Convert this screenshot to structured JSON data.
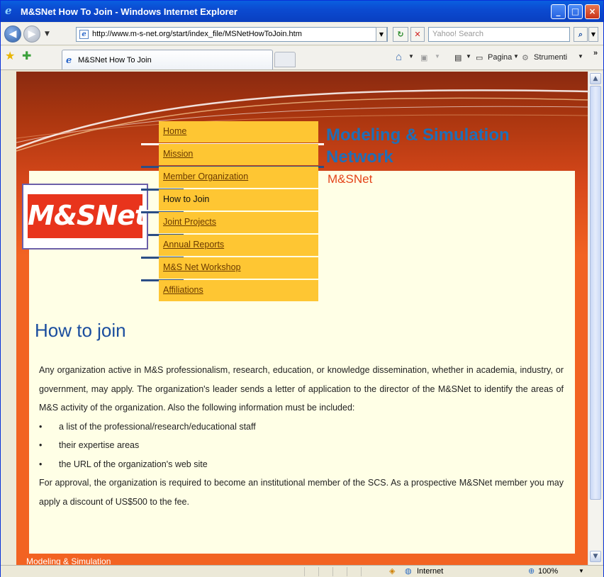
{
  "window": {
    "title": "M&SNet How To Join - Windows Internet Explorer",
    "minimize_label": "_",
    "maximize_label": "□",
    "close_label": "×"
  },
  "toolbar": {
    "address": "http://www.m-s-net.org/start/index_file/MSNetHowToJoin.htm",
    "search_placeholder": "Yahoo! Search"
  },
  "tabs": {
    "active_label": "M&SNet How To Join",
    "pagina_label": "Pagina",
    "strumenti_label": "Strumenti"
  },
  "site": {
    "title": "Modeling & Simulation Network",
    "subtitle": "M&SNet",
    "logo_text": "M&SNet"
  },
  "nav": [
    {
      "label": "Home",
      "link": true
    },
    {
      "label": "Mission",
      "link": true
    },
    {
      "label": "Member Organization",
      "link": true
    },
    {
      "label": "How to Join",
      "link": false
    },
    {
      "label": "Joint Projects",
      "link": true
    },
    {
      "label": "Annual Reports",
      "link": true
    },
    {
      "label": "M&S Net Workshop",
      "link": true
    },
    {
      "label": "Affiliations",
      "link": true
    }
  ],
  "content": {
    "heading": "How to join",
    "intro": "Any organization active in M&S professionalism, research, education, or knowledge dissemination, whether in academia, industry, or government, may apply. The organization's leader sends a letter of application to the director of the M&SNet to identify the areas of M&S activity of the organization. Also the following information must be included:",
    "bullets": [
      "a list of the professional/research/educational staff",
      "their expertise areas",
      "the URL of the organization's web site"
    ],
    "closing": "For approval, the organization is required to become an institutional member of the SCS. As a prospective M&SNet member you may apply a discount of US$500 to the fee.",
    "footer_partial": "Modeling & Simulation"
  },
  "status": {
    "zone": "Internet",
    "zoom": "100%"
  }
}
